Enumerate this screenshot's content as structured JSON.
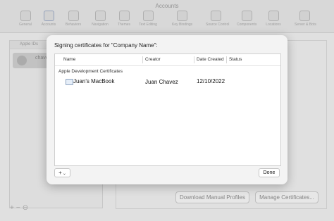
{
  "window": {
    "title": "Accounts"
  },
  "toolbar": [
    {
      "label": "General",
      "icon": "switch-icon"
    },
    {
      "label": "Accounts",
      "icon": "at-sign-icon"
    },
    {
      "label": "Behaviors",
      "icon": "behaviors-icon"
    },
    {
      "label": "Navigation",
      "icon": "navigation-icon"
    },
    {
      "label": "Themes",
      "icon": "themes-icon"
    },
    {
      "label": "Text Editing",
      "icon": "text-editing-icon"
    },
    {
      "label": "Key Bindings",
      "icon": "keyboard-icon"
    },
    {
      "label": "Source Control",
      "icon": "source-control-icon"
    },
    {
      "label": "Components",
      "icon": "components-icon"
    },
    {
      "label": "Locations",
      "icon": "locations-icon"
    },
    {
      "label": "Server & Bots",
      "icon": "server-icon"
    }
  ],
  "sidebar": {
    "header": "Apple IDs",
    "account_name": "chave",
    "add_label": "+",
    "remove_label": "−",
    "more_label": "⊖"
  },
  "background_buttons": {
    "download": "Download Manual Profiles",
    "manage": "Manage Certificates..."
  },
  "dialog": {
    "title": "Signing certificates for \"Company Name\":",
    "columns": [
      "Name",
      "Creator",
      "Date Created",
      "Status"
    ],
    "group": "Apple Development Certificates",
    "rows": [
      {
        "name": "Juan's MacBook",
        "creator": "Juan Chavez",
        "date": "12/10/2022",
        "status": ""
      }
    ],
    "add_label": "+",
    "add_chevron": "⌄",
    "done_label": "Done"
  }
}
